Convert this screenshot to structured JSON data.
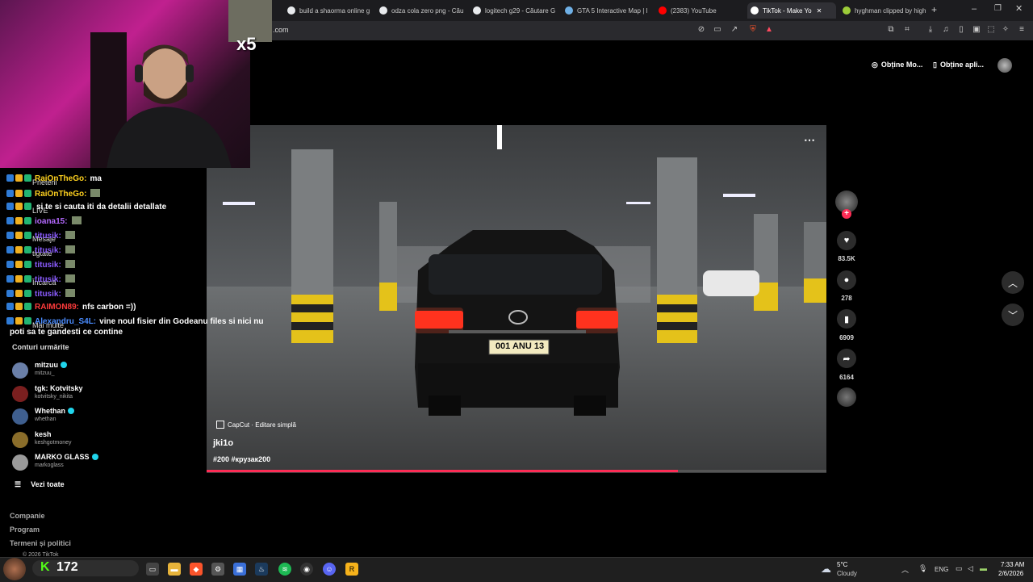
{
  "browser": {
    "tabs": [
      {
        "title": "build a shaorma online g",
        "color": "#e8eaed"
      },
      {
        "title": "odza cola zero png - Cău",
        "color": "#e8eaed"
      },
      {
        "title": "logitech g29 - Căutare G",
        "color": "#e8eaed"
      },
      {
        "title": "GTA 5 Interactive Map | I",
        "color": "#6fb0e6"
      },
      {
        "title": "(2383) YouTube",
        "color": "#ff0000"
      },
      {
        "title": "TikTok - Make Yo",
        "color": "#ffffff"
      },
      {
        "title": "hyghman clipped by high",
        "color": "#9ccc39"
      }
    ],
    "url": ".com"
  },
  "stream": {
    "emote_multiplier": "x5"
  },
  "chat": [
    {
      "user": "RaiOnTheGo:",
      "msg": "ma",
      "color": "#ffd21f",
      "under": "Prieteni"
    },
    {
      "user": "RaiOnTheGo:",
      "msg": "",
      "color": "#ffd21f",
      "under": ""
    },
    {
      "user": "",
      "msg": "si te si cauta iti da detalii detallate",
      "color": "#ffffff",
      "under": "LIVE"
    },
    {
      "user": "ioana15:",
      "msg": "",
      "color": "#b469ff",
      "under": ""
    },
    {
      "user": "titusik:",
      "msg": "",
      "color": "#8b5cff",
      "under": "Mesaje"
    },
    {
      "user": "titusik:",
      "msg": "",
      "color": "#8b5cff",
      "under": "tigtate"
    },
    {
      "user": "titusik:",
      "msg": "",
      "color": "#8b5cff",
      "under": ""
    },
    {
      "user": "titusik:",
      "msg": "",
      "color": "#8b5cff",
      "under": "Încarcă"
    },
    {
      "user": "titusik:",
      "msg": "",
      "color": "#8b5cff",
      "under": ""
    },
    {
      "user": "RAIMON89:",
      "msg": "nfs carbon =))",
      "color": "#ff3b3b",
      "under": ""
    },
    {
      "user": "Alexandru_S4L:",
      "msg": "vine noul fisier din Godeanu files si nici nu",
      "color": "#4a8cff",
      "under": "Mai multe"
    },
    {
      "user": "",
      "msg": "poti sa te gandesti ce contine",
      "color": "#ffffff",
      "under": ""
    }
  ],
  "tiktok": {
    "get_coins": "Obține Mo...",
    "get_app": "Obține apli...",
    "following_header": "Conturi urmărite",
    "following": [
      {
        "name": "mitzuu",
        "handle": "mitzuu_",
        "verified": true,
        "avatar_color": "#6a7fa8"
      },
      {
        "name": "tgk: Kotvitsky",
        "handle": "kotvitsky_nikita",
        "verified": false,
        "avatar_color": "#7a1f1f"
      },
      {
        "name": "Whethan",
        "handle": "whethan",
        "verified": true,
        "avatar_color": "#3f5f8f"
      },
      {
        "name": "kesh",
        "handle": "keshgotmoney",
        "verified": false,
        "avatar_color": "#8a6d2a"
      },
      {
        "name": "MARKO GLASS",
        "handle": "markoglass",
        "verified": true,
        "avatar_color": "#9a9a9a"
      }
    ],
    "see_all": "Vezi toate",
    "footer": [
      "Companie",
      "Program",
      "Termeni și politici",
      "© 2026 TikTok"
    ],
    "video": {
      "capcut": "CapCut · Editare simplă",
      "author": "jki1o",
      "hashtags": "#200 #крузак200",
      "plate": "001 ANU 13",
      "progress": 0.76
    },
    "actions": {
      "likes": "83.5K",
      "comments": "278",
      "saves": "6909",
      "shares": "6164"
    }
  },
  "overlay": {
    "viewer_count": "172"
  },
  "taskbar": {
    "weather_temp": "5°C",
    "weather_desc": "Cloudy",
    "lang": "ENG",
    "time": "7:33 AM",
    "date": "2/6/2026"
  }
}
